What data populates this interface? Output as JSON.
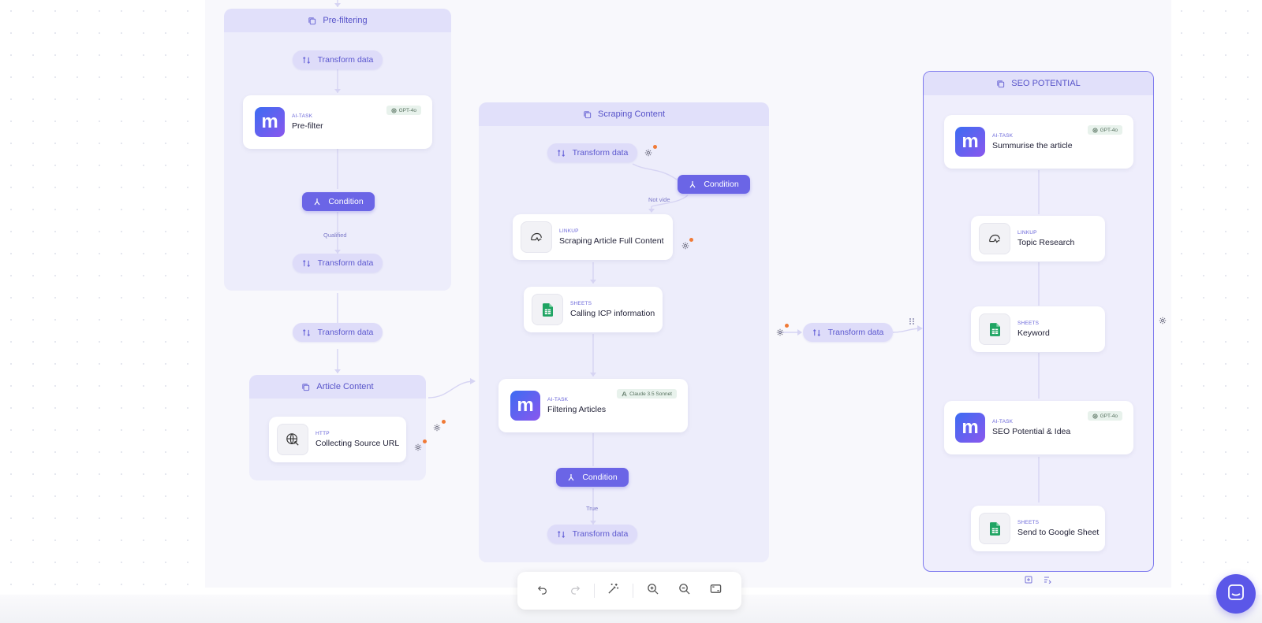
{
  "groups": {
    "prefiltering": "Pre-filtering",
    "scraping": "Scraping Content",
    "seo": "SEO POTENTIAL",
    "article": "Article Content"
  },
  "pills": {
    "transform": "Transform data"
  },
  "conditions": {
    "label": "Condition"
  },
  "edge_labels": {
    "qualified": "Qualified",
    "not_vide": "Not vide",
    "true": "True"
  },
  "nodes": {
    "prefilter": {
      "category": "AI-TASK",
      "title": "Pre-filter",
      "badge": "GPT-4o"
    },
    "collecting": {
      "category": "HTTP",
      "title": "Collecting Source URL"
    },
    "scraping": {
      "category": "LINKUP",
      "title": "Scraping Article Full Content"
    },
    "calling": {
      "category": "SHEETS",
      "title": "Calling ICP information"
    },
    "filtering": {
      "category": "AI-TASK",
      "title": "Filtering Articles",
      "badge": "Claude 3.5 Sonnet"
    },
    "summarise": {
      "category": "AI-TASK",
      "title": "Summurise the article",
      "badge": "GPT-4o"
    },
    "topic": {
      "category": "LINKUP",
      "title": "Topic Research"
    },
    "keyword": {
      "category": "SHEETS",
      "title": "Keyword"
    },
    "seoidea": {
      "category": "AI-TASK",
      "title": "SEO Potential & Idea",
      "badge": "GPT-4o"
    },
    "sendsheet": {
      "category": "SHEETS",
      "title": "Send to Google Sheet"
    }
  },
  "ai_logo": "m",
  "colors": {
    "accent": "#6b65e6",
    "group_bg": "#ededfb",
    "warning_dot": "#f07a36"
  },
  "toolbar": {
    "undo": "undo-icon",
    "redo": "redo-icon",
    "magic": "magic-wand-icon",
    "zoom_in": "zoom-in-icon",
    "zoom_out": "zoom-out-icon",
    "fit": "fit-screen-icon"
  }
}
